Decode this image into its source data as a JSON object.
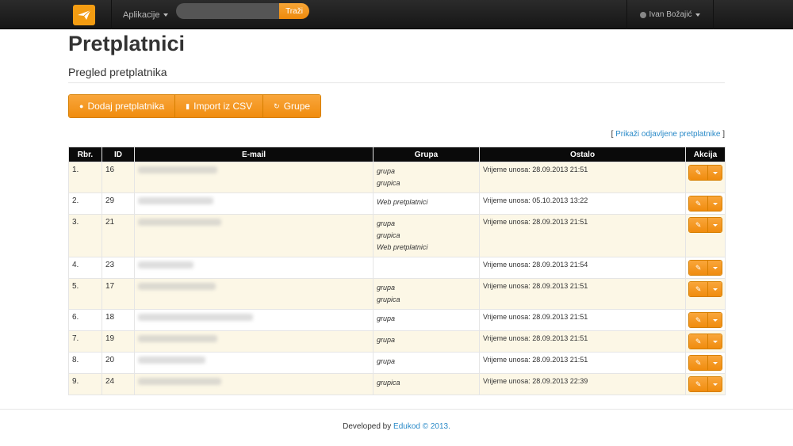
{
  "navbar": {
    "apps_label": "Aplikacije",
    "search_placeholder": "",
    "search_button": "Traži",
    "user_name": "Ivan Božajić"
  },
  "page": {
    "title": "Pretplatnici",
    "subtitle": "Pregled pretplatnika"
  },
  "toolbar": {
    "add_label": "Dodaj pretplatnika",
    "import_label": "Import iz CSV",
    "groups_label": "Grupe"
  },
  "toggle": {
    "open": "[",
    "link": "Prikaži odjavljene pretplatnike",
    "close": "]"
  },
  "table": {
    "headers": [
      "Rbr.",
      "ID",
      "E-mail",
      "Grupa",
      "Ostalo",
      "Akcija"
    ],
    "rows": [
      {
        "rbr": "1.",
        "id": "16",
        "groups": [
          "grupa",
          "grupica"
        ],
        "ostalo": "Vrijeme unosa: 28.09.2013 21:51"
      },
      {
        "rbr": "2.",
        "id": "29",
        "groups": [
          "Web pretplatnici"
        ],
        "ostalo": "Vrijeme unosa: 05.10.2013 13:22"
      },
      {
        "rbr": "3.",
        "id": "21",
        "groups": [
          "grupa",
          "grupica",
          "Web pretplatnici"
        ],
        "ostalo": "Vrijeme unosa: 28.09.2013 21:51"
      },
      {
        "rbr": "4.",
        "id": "23",
        "groups": [],
        "ostalo": "Vrijeme unosa: 28.09.2013 21:54"
      },
      {
        "rbr": "5.",
        "id": "17",
        "groups": [
          "grupa",
          "grupica"
        ],
        "ostalo": "Vrijeme unosa: 28.09.2013 21:51"
      },
      {
        "rbr": "6.",
        "id": "18",
        "groups": [
          "grupa"
        ],
        "ostalo": "Vrijeme unosa: 28.09.2013 21:51"
      },
      {
        "rbr": "7.",
        "id": "19",
        "groups": [
          "grupa"
        ],
        "ostalo": "Vrijeme unosa: 28.09.2013 21:51"
      },
      {
        "rbr": "8.",
        "id": "20",
        "groups": [
          "grupa"
        ],
        "ostalo": "Vrijeme unosa: 28.09.2013 21:51"
      },
      {
        "rbr": "9.",
        "id": "24",
        "groups": [
          "grupica"
        ],
        "ostalo": "Vrijeme unosa: 28.09.2013 22:39"
      }
    ]
  },
  "footer": {
    "prefix": "Developed by",
    "link": "Edukod © 2013."
  },
  "colors": {
    "accent": "#f39c12",
    "link": "#2a8ac8",
    "row_highlight": "#fcf7e6"
  }
}
